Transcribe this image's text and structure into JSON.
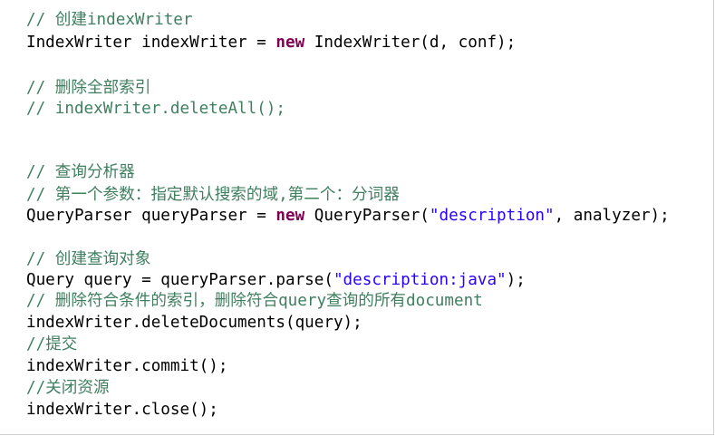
{
  "code_editor": {
    "lines": [
      [
        {
          "t": "// 创建indexWriter",
          "k": "comment"
        }
      ],
      [
        {
          "t": "IndexWriter indexWriter = ",
          "k": "plain"
        },
        {
          "t": "new",
          "k": "keyword"
        },
        {
          "t": " IndexWriter(d, conf);",
          "k": "plain"
        }
      ],
      [],
      [
        {
          "t": "// 删除全部索引",
          "k": "comment"
        }
      ],
      [
        {
          "t": "// indexWriter.deleteAll();",
          "k": "comment"
        }
      ],
      [],
      [],
      [
        {
          "t": "// 查询分析器",
          "k": "comment"
        }
      ],
      [
        {
          "t": "// 第一个参数：指定默认搜索的域,第二个：分词器",
          "k": "comment"
        }
      ],
      [
        {
          "t": "QueryParser queryParser = ",
          "k": "plain"
        },
        {
          "t": "new",
          "k": "keyword"
        },
        {
          "t": " QueryParser(",
          "k": "plain"
        },
        {
          "t": "\"description\"",
          "k": "string"
        },
        {
          "t": ", analyzer);",
          "k": "plain"
        }
      ],
      [],
      [
        {
          "t": "// 创建查询对象",
          "k": "comment"
        }
      ],
      [
        {
          "t": "Query query = queryParser.parse(",
          "k": "plain"
        },
        {
          "t": "\"description:java\"",
          "k": "string"
        },
        {
          "t": ");",
          "k": "plain"
        }
      ],
      [
        {
          "t": "// 删除符合条件的索引，删除符合query查询的所有document",
          "k": "comment"
        }
      ],
      [
        {
          "t": "indexWriter.deleteDocuments(query);",
          "k": "plain"
        }
      ],
      [
        {
          "t": "//提交",
          "k": "comment"
        }
      ],
      [
        {
          "t": "indexWriter.commit();",
          "k": "plain"
        }
      ],
      [
        {
          "t": "//关闭资源",
          "k": "comment"
        }
      ],
      [
        {
          "t": "indexWriter.close();",
          "k": "plain"
        }
      ]
    ]
  },
  "syntax_colors": {
    "comment": "#3f7f5f",
    "keyword": "#7f0055",
    "string": "#2a00ff",
    "plain": "#000000"
  }
}
